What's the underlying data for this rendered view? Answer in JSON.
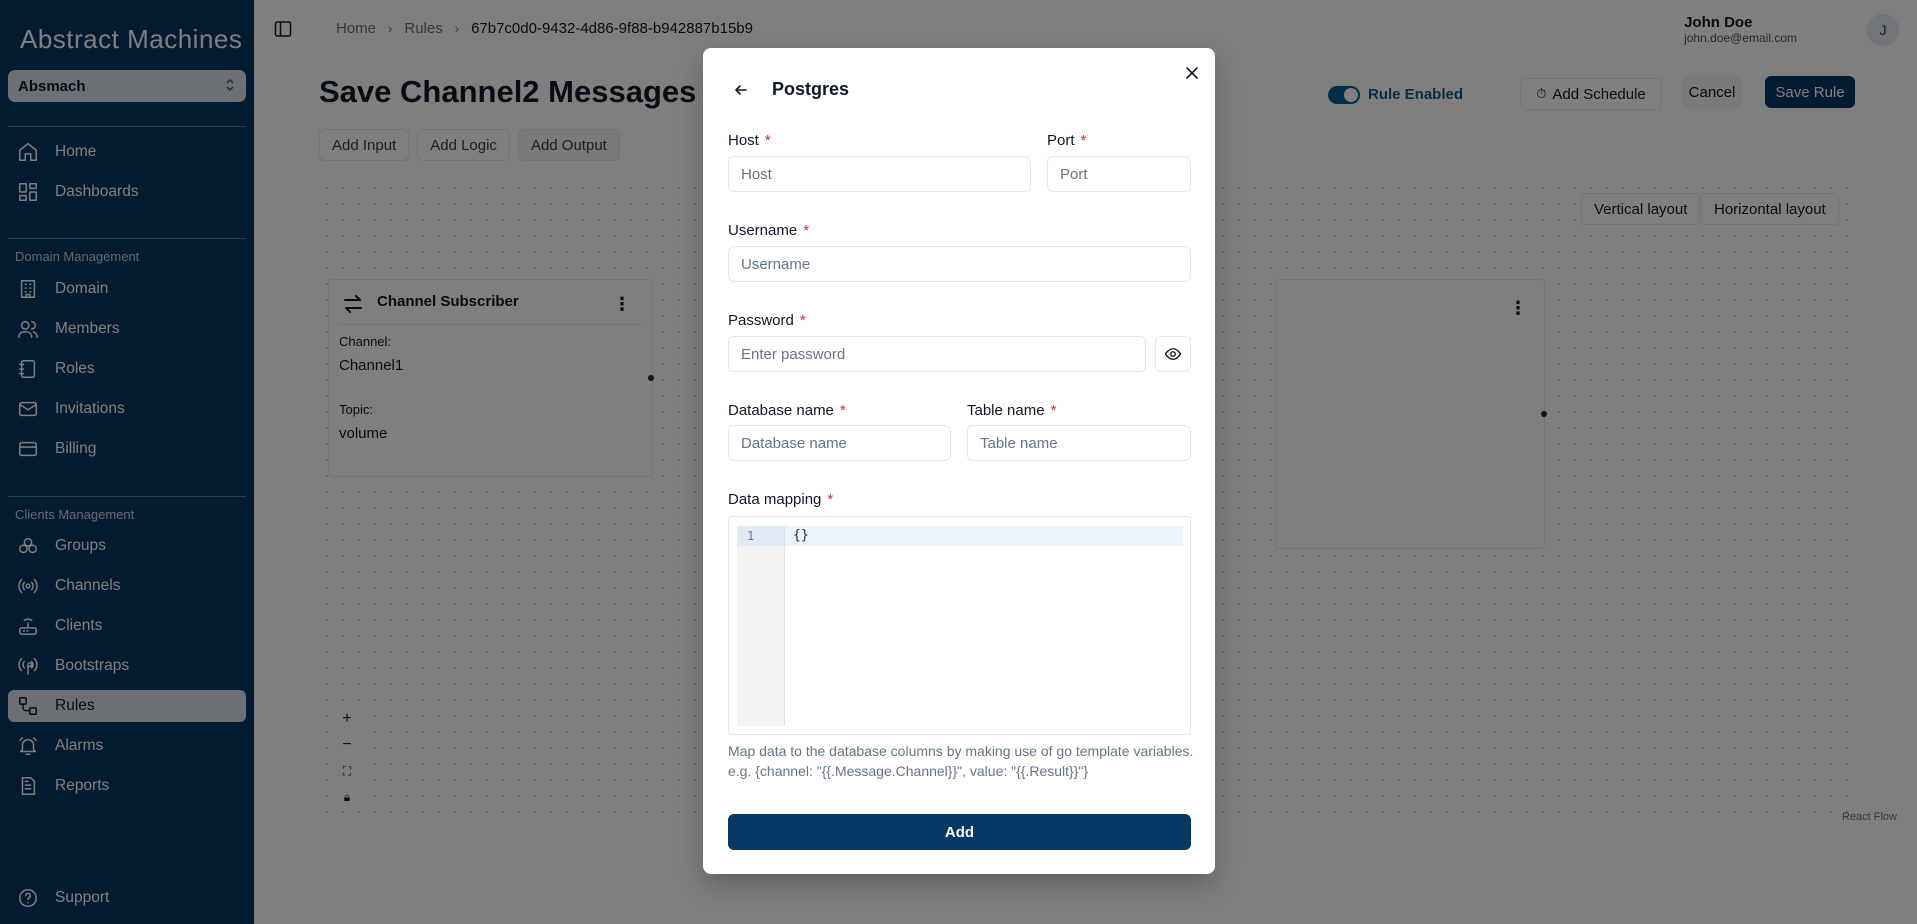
{
  "sidebar": {
    "logo": "Abstract Machines",
    "workspace": "Absmach",
    "items_top": [
      {
        "label": "Home",
        "icon": "home-icon"
      },
      {
        "label": "Dashboards",
        "icon": "dashboard-icon"
      }
    ],
    "section_domain": "Domain Management",
    "items_domain": [
      {
        "label": "Domain",
        "icon": "building-icon"
      },
      {
        "label": "Members",
        "icon": "users-icon"
      },
      {
        "label": "Roles",
        "icon": "notebook-icon"
      },
      {
        "label": "Invitations",
        "icon": "mail-icon"
      },
      {
        "label": "Billing",
        "icon": "credit-card-icon"
      }
    ],
    "section_clients": "Clients Management",
    "items_clients": [
      {
        "label": "Groups",
        "icon": "groups-icon"
      },
      {
        "label": "Channels",
        "icon": "radio-icon"
      },
      {
        "label": "Clients",
        "icon": "router-icon"
      },
      {
        "label": "Bootstraps",
        "icon": "antenna-icon"
      },
      {
        "label": "Rules",
        "icon": "workflow-icon",
        "active": true
      },
      {
        "label": "Alarms",
        "icon": "alarm-bell-icon"
      },
      {
        "label": "Reports",
        "icon": "report-icon"
      }
    ],
    "support": "Support"
  },
  "header": {
    "breadcrumb": [
      "Home",
      "Rules",
      "67b7c0d0-9432-4d86-9f88-b942887b15b9"
    ],
    "user_name": "John Doe",
    "user_email": "john.doe@email.com",
    "avatar_initial": "J"
  },
  "page": {
    "title": "Save Channel2 Messages",
    "rule_enabled_label": "Rule Enabled",
    "add_schedule": "Add Schedule",
    "cancel": "Cancel",
    "save": "Save Rule",
    "tabs": [
      "Add Input",
      "Add Logic",
      "Add Output"
    ],
    "vertical_layout": "Vertical layout",
    "horizontal_layout": "Horizontal layout",
    "node": {
      "title": "Channel Subscriber",
      "channel_label": "Channel:",
      "channel_value": "Channel1",
      "topic_label": "Topic:",
      "topic_value": "volume"
    },
    "react_flow": "React Flow"
  },
  "modal": {
    "title": "Postgres",
    "host_label": "Host",
    "host_placeholder": "Host",
    "port_label": "Port",
    "port_placeholder": "Port",
    "username_label": "Username",
    "username_placeholder": "Username",
    "password_label": "Password",
    "password_placeholder": "Enter password",
    "dbname_label": "Database name",
    "dbname_placeholder": "Database name",
    "table_label": "Table name",
    "table_placeholder": "Table name",
    "mapping_label": "Data mapping",
    "mapping_line_number": "1",
    "mapping_value": "{}",
    "help": "Map data to the database columns by making use of go template variables. e.g. {channel: \"{{.Message.Channel}}\", value: \"{{.Result}}\"}",
    "submit": "Add",
    "required_mark": "*"
  }
}
